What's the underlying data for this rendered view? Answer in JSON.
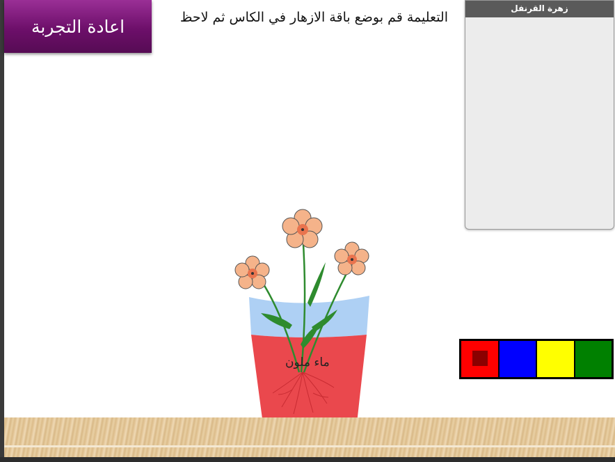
{
  "toolbar": {
    "retry_label": "اعادة التجربة"
  },
  "instruction": "التعليمة قم بوضع باقة الازهار في الكاس ثم لاحظ",
  "info_panel": {
    "title": "زهرة القرنفل"
  },
  "cup": {
    "label": "ماء ملون"
  },
  "color_options": [
    {
      "name": "red",
      "color": "#ff0000",
      "selected": true
    },
    {
      "name": "blue",
      "color": "#0000ff",
      "selected": false
    },
    {
      "name": "yellow",
      "color": "#ffff00",
      "selected": false
    },
    {
      "name": "green",
      "color": "#008000",
      "selected": false
    }
  ],
  "colors": {
    "button_purple": "#7a1877",
    "water_top": "#b2d3f5",
    "water_colored": "#e8383e",
    "flower_petal": "#f5b38a",
    "stem_green": "#2e8b2e"
  }
}
